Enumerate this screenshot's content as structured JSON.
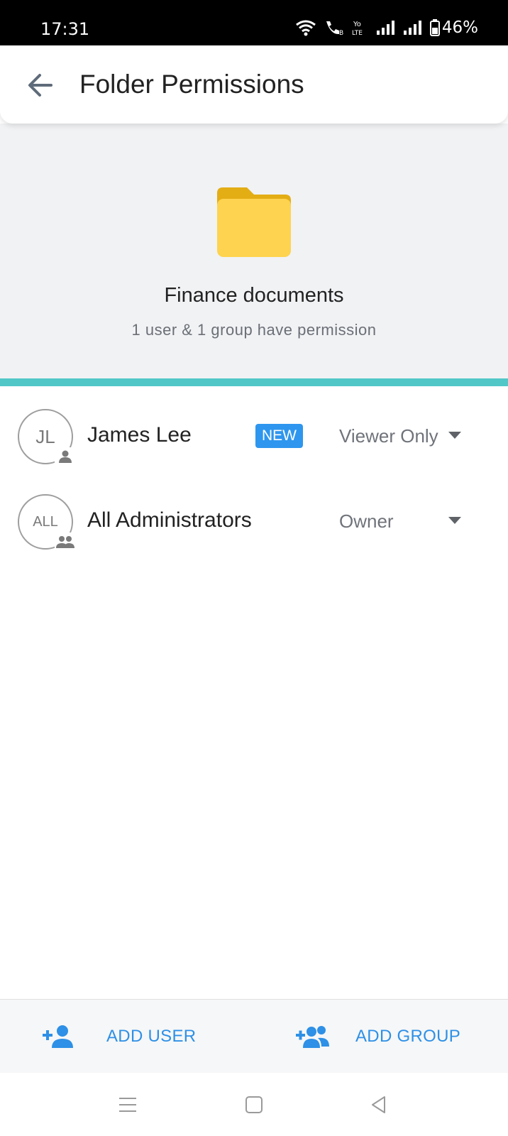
{
  "status_bar": {
    "time": "17:31",
    "battery": "46%",
    "icons": [
      "wifi-icon",
      "wifi-calling-icon",
      "volte-icon",
      "signal-icon",
      "signal-icon",
      "battery-icon"
    ]
  },
  "header": {
    "title": "Folder Permissions",
    "back_icon": "arrow-back-icon"
  },
  "folder": {
    "name": "Finance documents",
    "summary": "1 user & 1 group have permission",
    "icon": "folder-icon",
    "color": "#fdd34f"
  },
  "permissions": [
    {
      "initials": "JL",
      "name": "James Lee",
      "type": "user",
      "badge": "NEW",
      "role": "Viewer Only"
    },
    {
      "initials": "ALL",
      "name": "All Administrators",
      "type": "group",
      "badge": "",
      "role": "Owner"
    }
  ],
  "actions": {
    "add_user": "ADD USER",
    "add_group": "ADD GROUP"
  },
  "colors": {
    "accent": "#2e90e6",
    "divider": "#52c7c7",
    "header_bg": "#f1f2f4"
  },
  "nav": [
    "menu-icon",
    "home-icon",
    "back-icon"
  ]
}
